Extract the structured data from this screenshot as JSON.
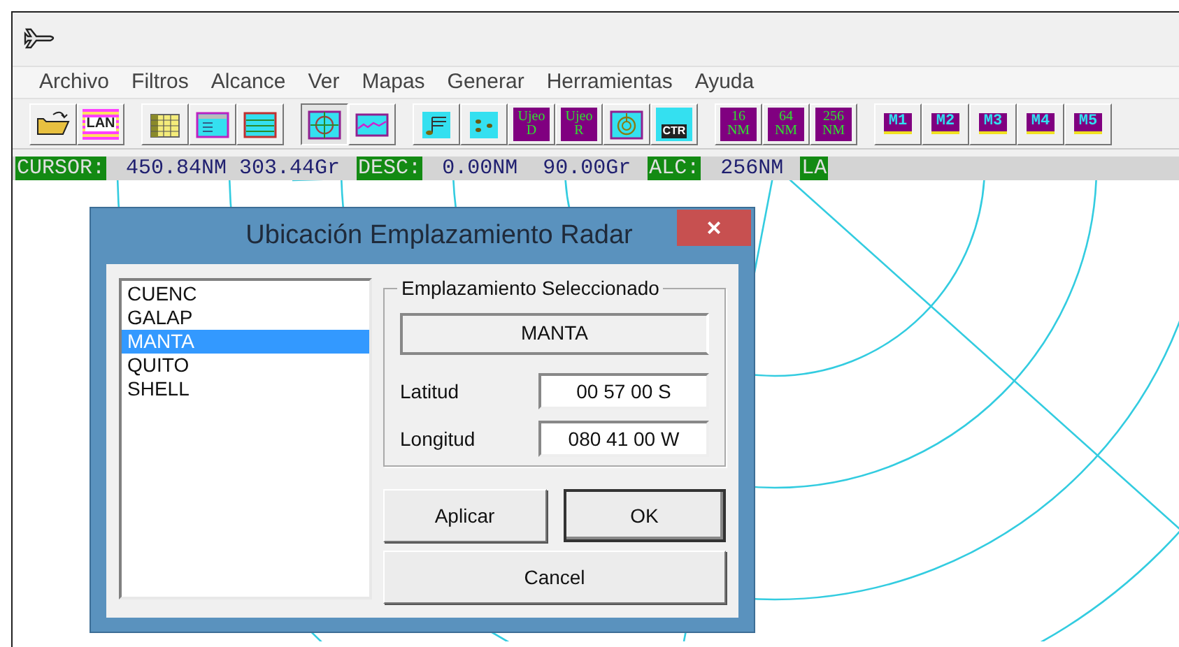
{
  "menu": [
    "Archivo",
    "Filtros",
    "Alcance",
    "Ver",
    "Mapas",
    "Generar",
    "Herramientas",
    "Ayuda"
  ],
  "toolbar": [
    [
      {
        "kind": "open",
        "pressed": false
      },
      {
        "kind": "lan",
        "label": "LAN",
        "pressed": false
      }
    ],
    [
      {
        "kind": "table",
        "pressed": false
      },
      {
        "kind": "grid",
        "pressed": false
      },
      {
        "kind": "lines",
        "pressed": false
      }
    ],
    [
      {
        "kind": "target",
        "pressed": true
      },
      {
        "kind": "wave",
        "pressed": false
      }
    ],
    [
      {
        "kind": "chart",
        "pressed": false
      },
      {
        "kind": "dots",
        "pressed": false
      },
      {
        "kind": "text",
        "lines": [
          "Ujeo",
          "D"
        ],
        "pressed": false
      },
      {
        "kind": "text",
        "lines": [
          "Ujeo",
          "R"
        ],
        "pressed": false
      },
      {
        "kind": "rings",
        "pressed": false
      },
      {
        "kind": "ctr",
        "label": "CTR",
        "pressed": false
      }
    ],
    [
      {
        "kind": "range",
        "lines": [
          "16",
          "NM"
        ],
        "pressed": false
      },
      {
        "kind": "range",
        "lines": [
          "64",
          "NM"
        ],
        "pressed": false
      },
      {
        "kind": "range",
        "lines": [
          "256",
          "NM"
        ],
        "pressed": false
      }
    ],
    [
      {
        "kind": "memory",
        "label": "M1",
        "pressed": false
      },
      {
        "kind": "memory",
        "label": "M2",
        "pressed": false
      },
      {
        "kind": "memory",
        "label": "M3",
        "pressed": false
      },
      {
        "kind": "memory",
        "label": "M4",
        "pressed": false
      },
      {
        "kind": "memory",
        "label": "M5",
        "pressed": false
      }
    ]
  ],
  "status_bar": [
    {
      "kind": "label",
      "text": "CURSOR:"
    },
    {
      "kind": "value",
      "text": "450.84NM 303.44Gr"
    },
    {
      "kind": "label",
      "text": "DESC:"
    },
    {
      "kind": "value",
      "text": "0.00NM  90.00Gr"
    },
    {
      "kind": "label",
      "text": "ALC:"
    },
    {
      "kind": "value",
      "text": "256NM"
    },
    {
      "kind": "label",
      "text": "LA"
    }
  ],
  "dialog": {
    "title": "Ubicación Emplazamiento Radar",
    "close": "×",
    "sites": [
      {
        "name": "CUENC",
        "selected": false
      },
      {
        "name": "GALAP",
        "selected": false
      },
      {
        "name": "MANTA",
        "selected": true
      },
      {
        "name": "QUITO",
        "selected": false
      },
      {
        "name": "SHELL",
        "selected": false
      }
    ],
    "group_title": "Emplazamiento Seleccionado",
    "selected_site": "MANTA",
    "fields": [
      {
        "label": "Latitud",
        "value": "00 57 00 S"
      },
      {
        "label": "Longitud",
        "value": "080 41 00 W"
      }
    ],
    "buttons": [
      {
        "label": "Aplicar",
        "default": false
      },
      {
        "label": "OK",
        "default": true
      },
      {
        "label": "Cancel",
        "default": false
      }
    ]
  }
}
